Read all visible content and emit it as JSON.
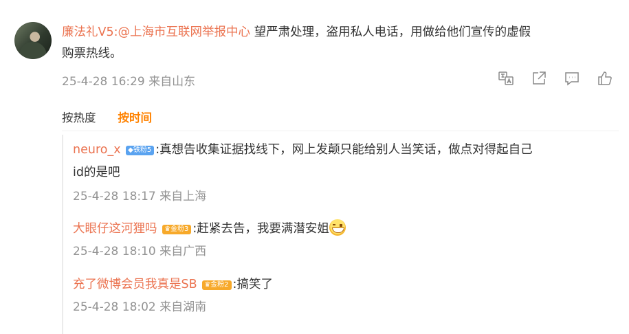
{
  "main_comment": {
    "username": "廉法礼V5",
    "mention": ":@上海市互联网举报中心",
    "text_line1": " 望严肃处理，盗用私人电话，用做给他们宣传的虚假",
    "text_line2": "购票热线。",
    "time": "25-4-28 16:29 来自山东",
    "actions": [
      "translate-icon",
      "share-icon",
      "comment-icon",
      "like-icon"
    ]
  },
  "sort": {
    "hot_label": "按热度",
    "time_label": "按时间",
    "active": "time"
  },
  "replies": [
    {
      "username": "neuro_x",
      "badge": "铁粉5",
      "text_line1": ":真想告收集证据找线下，网上发颠只能给别人当笑话，做点对得起自己",
      "text_line2": "id的是吧",
      "time": "25-4-28 18:17 来自上海"
    },
    {
      "username": "大眼仔这河狸吗",
      "badge": "金粉3",
      "text": ":赶紧去告，我要满潜安姐",
      "emoji": "grin-emoji",
      "time": "25-4-28 18:10 来自广西"
    },
    {
      "username": "充了微博会员我真是SB",
      "badge": "金粉2",
      "text": ":搞笑了",
      "time": "25-4-28 18:02 来自湖南"
    }
  ],
  "colors": {
    "username": "#eb7350",
    "active_sort": "#ff8200",
    "meta": "#939393",
    "iron_badge": "#5aa3f0",
    "gold_badge": "#f7a92a"
  }
}
